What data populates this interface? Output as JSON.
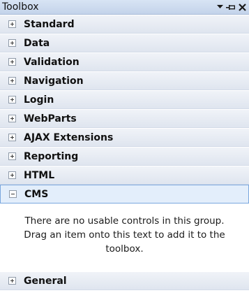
{
  "window": {
    "title": "Toolbox",
    "buttons": {
      "dropdown_icon": "chevron-down-icon",
      "pin_icon": "pin-icon",
      "close_icon": "close-icon"
    }
  },
  "groups": [
    {
      "label": "Standard",
      "expanded": false
    },
    {
      "label": "Data",
      "expanded": false
    },
    {
      "label": "Validation",
      "expanded": false
    },
    {
      "label": "Navigation",
      "expanded": false
    },
    {
      "label": "Login",
      "expanded": false
    },
    {
      "label": "WebParts",
      "expanded": false
    },
    {
      "label": "AJAX Extensions",
      "expanded": false
    },
    {
      "label": "Reporting",
      "expanded": false
    },
    {
      "label": "HTML",
      "expanded": false
    },
    {
      "label": "CMS",
      "expanded": true,
      "selected": true
    },
    {
      "label": "General",
      "expanded": false
    }
  ],
  "cms_group": {
    "empty_message": "There are no usable controls in this group. Drag an item onto this text to add it to the toolbox."
  },
  "colors": {
    "selected_header_bg": "#e3eefb",
    "selected_header_border": "#7aa7de",
    "titlebar_bg": "#c3d3ea"
  }
}
